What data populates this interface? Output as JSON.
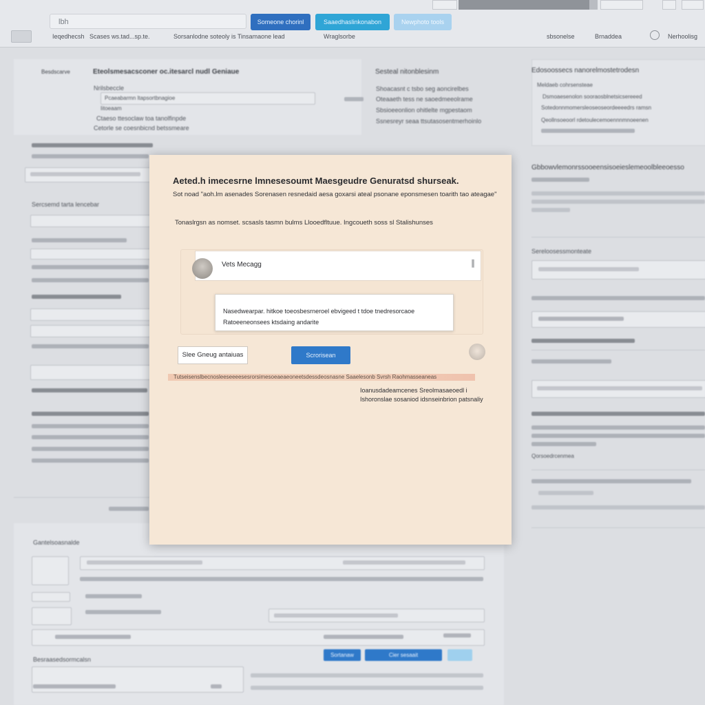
{
  "topbar": {
    "search_value": "lbh",
    "buttons": [
      "Someone chorinl",
      "Saaedhaslinkonabon",
      "Newphoto tools"
    ],
    "menu": [
      "Ieqedhecsh",
      "Scases ws.tad...sp.te.",
      "Sorsanlodne soteoly is Tinsamaone lead",
      "Wraglsorbe",
      "sbsonelse",
      "Brnaddea"
    ],
    "progress": 0.94,
    "right_label": "Nerhoolisg"
  },
  "background": {
    "left_heading": "Besdscarve",
    "section_title": "Eteolsmesacsconer oc.itesarcl nudl Geniaue",
    "section_label": "Nrilsbeccle",
    "field_value": "Pcaeabarmn ltapsortbnagioe",
    "field_caption": "Iitoeaam",
    "note_1": "Ctaeso ttesoclaw toa tanolfinpde",
    "note_2": "Cetorle se coesnbicnd betssmeare",
    "mid_heading": "Sesteal nitonblesinm",
    "mid_lines": [
      "Shoacasnt c tsbo seg aoncirelbes",
      "Oteaaeth tess ne saoedmeeolrame",
      "Sbsioeeonlion ohitlelte mgpestaom",
      "Ssnesreyr seaa ttsutasosentmerhoinlo"
    ],
    "left_label": "Sercsemd tarta lencebar",
    "right_heading": "Edosoossecs nanorelmostetrodesn",
    "right_items": [
      "Meldaeb cohrsensteae",
      "Dsmoaesenolon sooraosblnetsicsereeed",
      "Sotedonnmomersleoseoseordeeeedrs ramsn",
      "Qeollnsoeoorl rdetoulecemoennnmnoeenen"
    ],
    "right_section": "Gbbowvlemonrssooeensisoeieslemeoolbleeoesso",
    "right_sub": "Sereloosessmonteate",
    "right_label_2": "Qorsoedrcenmea",
    "bottom_heading": "Gantelsoasnalde",
    "bottom_buttons": [
      "Sortanaw",
      "Cier sesaait"
    ],
    "bottom_label": "Besraasedsormcalsn"
  },
  "modal": {
    "title": "Aeted.h imecesrne lmnesesoumt Maesgeudre Genuratsd shurseak.",
    "subtitle": "Sot noad \"aoh.lm asenades Sorenasen resnedaid aesa goxarsi ateal psonane eponsmesen toarith tao ateagae\"",
    "instruction": "Tonaslrgsn as nomset. scsasls tasmn bulms Llooedfltuue. Ingcoueth soss sl Stalishunses",
    "user_name": "Vets Mecagg",
    "message": "Nasedwearpar. hitkoe toeosbesrneroel ebvigeed t tdoe tnedresorcaoe Ratoeeneonsees ktsdaing andarite",
    "secondary_button": "Slee Gneug antaiuas",
    "primary_button": "Scrorisean",
    "highlight": "Tutseisenslbecnosleeseeeesesrorsimesoeaeaeoneetsdessdeosnasne Saaelesonb Svrsh Raohmasseaneas",
    "footnote_line_1": "Ioanusdadeamcenes Sreolmasaeoedl i",
    "footnote_line_2": "Ishoronslae sosaniod idsnseinbrion patsnaliy"
  }
}
